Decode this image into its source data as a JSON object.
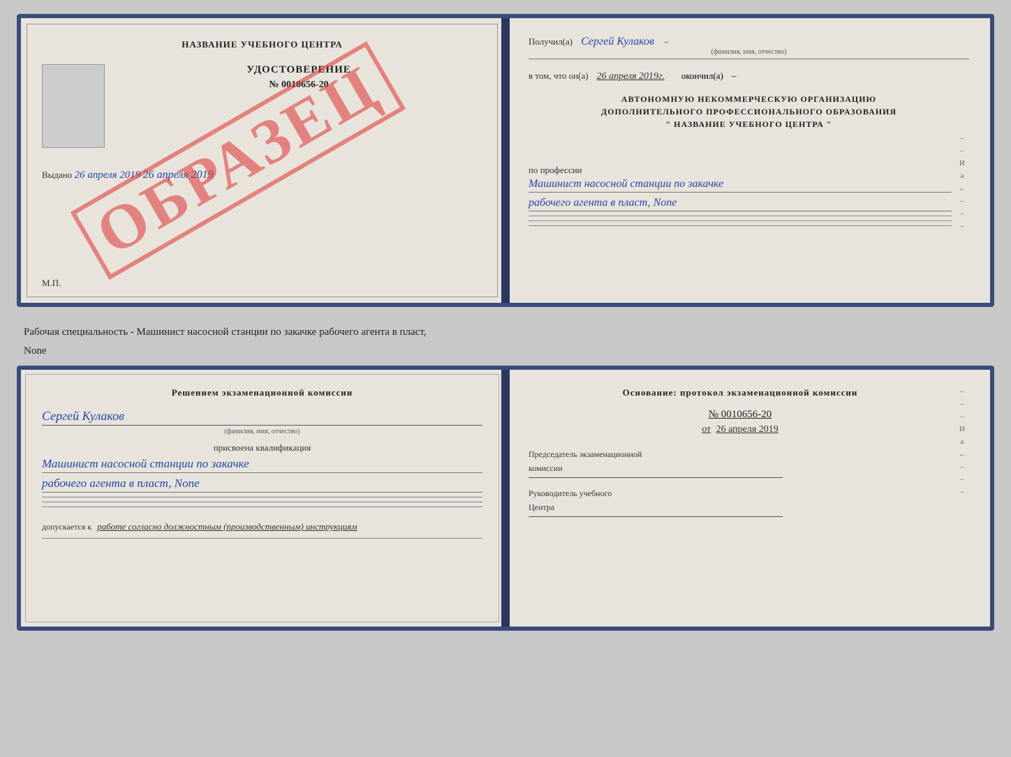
{
  "page": {
    "background": "#c8c8c8"
  },
  "cert_top": {
    "left": {
      "title": "НАЗВАНИЕ УЧЕБНОГО ЦЕНТРА",
      "udostoverenie": "УДОСТОВЕРЕНИЕ",
      "number": "№ 0010656-20",
      "vydano": "Выдано",
      "vydano_date": "26 апреля 2019",
      "mp": "М.П.",
      "watermark": "ОБРАЗЕЦ"
    },
    "right": {
      "poluchil_label": "Получил(а)",
      "poluchil_name": "Сергей Кулаков",
      "familiya_sub": "(фамилия, имя, отчество)",
      "vtom_label": "в том, что он(а)",
      "vtom_date": "26 апреля 2019г.",
      "okonchil": "окончил(а)",
      "org_line1": "АВТОНОМНУЮ НЕКОММЕРЧЕСКУЮ ОРГАНИЗАЦИЮ",
      "org_line2": "ДОПОЛНИТЕЛЬНОГО ПРОФЕССИОНАЛЬНОГО ОБРАЗОВАНИЯ",
      "org_line3": "\"    НАЗВАНИЕ УЧЕБНОГО ЦЕНТРА    \"",
      "po_professii": "по профессии",
      "profession_line1": "Машинист насосной станции по закачке",
      "profession_line2": "рабочего агента в пласт, None",
      "deco_letters": "И\nа\n←"
    }
  },
  "specialty_text": "Рабочая специальность - Машинист насосной станции по закачке рабочего агента в пласт,",
  "specialty_text2": "None",
  "cert_bottom": {
    "left": {
      "title": "Решением  экзаменационной  комиссии",
      "name_cursive": "Сергей Кулаков",
      "name_sub": "(фамилия, имя, отчество)",
      "prisvoena": "присвоена квалификация",
      "qual_line1": "Машинист насосной станции по закачке",
      "qual_line2": "рабочего агента в пласт, None",
      "dopuskaetsya_label": "допускается к",
      "dopuskaetsya_text": "работе согласно должностным (производственным) инструкциям"
    },
    "right": {
      "osnovaniye": "Основание: протокол экзаменационной комиссии",
      "protocol_num": "№ 0010656-20",
      "ot_label": "от",
      "ot_date": "26 апреля 2019",
      "predsedatel_label": "Председатель экзаменационной",
      "predsedatel_label2": "комиссии",
      "rukovoditel_label": "Руководитель учебного",
      "rukovoditel_label2": "Центра",
      "deco_letters": "И\nа\n←"
    }
  }
}
